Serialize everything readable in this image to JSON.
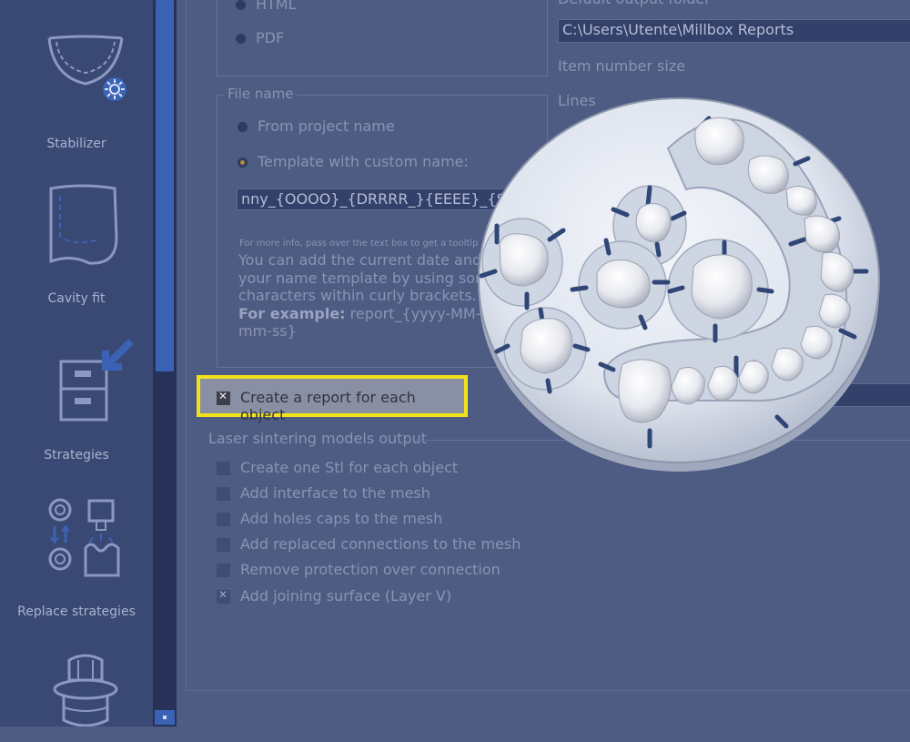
{
  "sidebar": {
    "items": [
      {
        "label": "Stabilizer",
        "icon": "stabilizer-icon"
      },
      {
        "label": "Cavity fit",
        "icon": "cavity-fit-icon"
      },
      {
        "label": "Strategies",
        "icon": "strategies-icon"
      },
      {
        "label": "Replace strategies",
        "icon": "replace-strategies-icon"
      },
      {
        "label": "",
        "icon": "implant-icon"
      }
    ]
  },
  "format": {
    "html_label": "HTML",
    "pdf_label": "PDF"
  },
  "output": {
    "folder_label": "Default output folder",
    "folder_value": "C:\\Users\\Utente\\Millbox Reports",
    "item_number_size_label": "Item number size",
    "lines_label": "Lines"
  },
  "file_name": {
    "group_title": "File name",
    "from_project_label": "From project name",
    "template_label": "Template with custom name:",
    "template_value": "nny_{OOOO}_{DRRRR_}{EEEE}_{S",
    "hint_small": "For more info, pass over the text box to get a tooltip",
    "hint_line1": "You can add the current date and",
    "hint_line2": "your name template by using some",
    "hint_line3": "characters within curly brackets.",
    "example_label": "For example:",
    "example_value": " report_{yyyy-MM-dd",
    "example_tail": "mm-ss}"
  },
  "report_each_object": {
    "label": "Create a report for each object",
    "checked": true
  },
  "laser": {
    "group_title": "Laser sintering models output",
    "options": [
      {
        "label": "Create one Stl for each object",
        "checked": false
      },
      {
        "label": "Add interface to the mesh",
        "checked": false
      },
      {
        "label": "Add holes caps to the mesh",
        "checked": false
      },
      {
        "label": "Add replaced connections to the mesh",
        "checked": false
      },
      {
        "label": "Remove protection over connection",
        "checked": false
      },
      {
        "label": "Add joining surface (Layer V)",
        "checked": true
      }
    ]
  },
  "colors": {
    "highlight_border": "#f2e21a",
    "scrollbar": "#3b63b5",
    "background": "#4e5c83"
  }
}
